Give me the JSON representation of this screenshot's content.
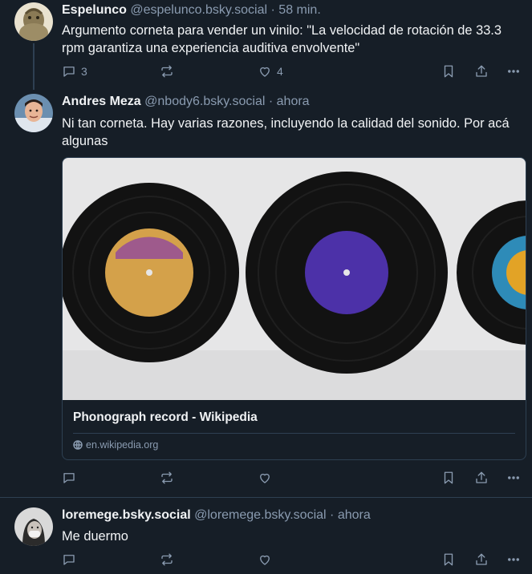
{
  "posts": [
    {
      "name": "Espelunco",
      "handle": "@espelunco.bsky.social",
      "separator": "·",
      "time": "58 min.",
      "text": "Argumento corneta para vender un vinilo: \"La velocidad de rotación de 33.3 rpm garantiza una experiencia auditiva envolvente\"",
      "replies": "3",
      "reposts": "",
      "likes": "4"
    },
    {
      "name": "Andres Meza",
      "handle": "@nbody6.bsky.social",
      "separator": "·",
      "time": "ahora",
      "text": "Ni tan corneta. Hay varias razones, incluyendo la calidad del sonido. Por acá algunas",
      "embed": {
        "title": "Phonograph record - Wikipedia",
        "domain": "en.wikipedia.org"
      },
      "replies": "",
      "reposts": "",
      "likes": ""
    },
    {
      "name": "loremege.bsky.social",
      "handle": "@loremege.bsky.social",
      "separator": "·",
      "time": "ahora",
      "text": "Me duermo",
      "replies": "",
      "reposts": "",
      "likes": ""
    }
  ],
  "icons": {
    "reply": "reply-icon",
    "repost": "repost-icon",
    "like": "heart-icon",
    "bookmark": "bookmark-icon",
    "share": "share-icon",
    "more": "more-icon"
  },
  "colors": {
    "background": "#161e27",
    "text": "#f1f3f5",
    "muted": "#8a9bb0",
    "border": "#2e4052"
  }
}
